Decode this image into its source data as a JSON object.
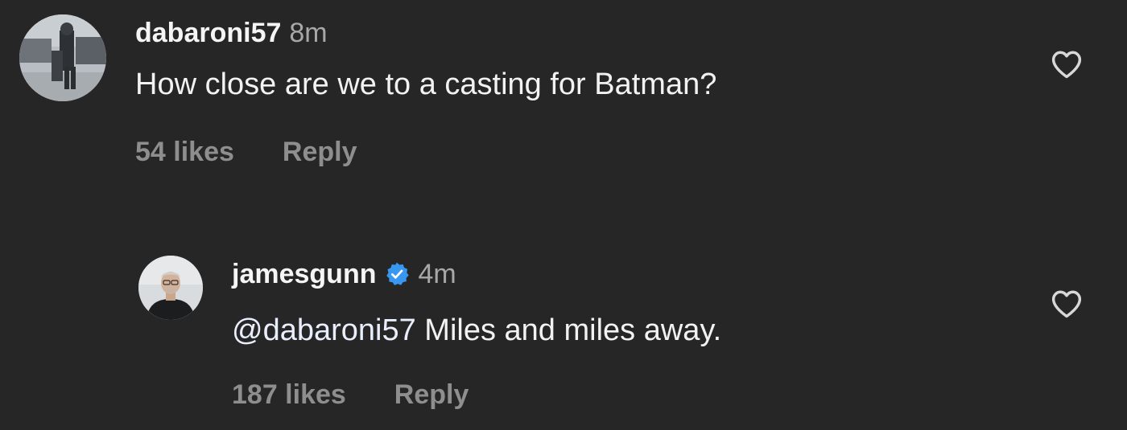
{
  "comments": [
    {
      "username": "dabaroni57",
      "time": "8m",
      "verified": false,
      "mention": "",
      "text": "How close are we to a casting for Batman?",
      "likes": "54 likes",
      "reply_label": "Reply",
      "avatar_icon": "street-photo-avatar",
      "like_icon": "heart-outline-icon"
    },
    {
      "username": "jamesgunn",
      "time": "4m",
      "verified": true,
      "mention": "@dabaroni57",
      "text": " Miles and miles away.",
      "likes": "187 likes",
      "reply_label": "Reply",
      "avatar_icon": "person-portrait-avatar",
      "like_icon": "heart-outline-icon"
    }
  ],
  "colors": {
    "background": "#262626",
    "text_primary": "#f2f2f2",
    "text_secondary": "#a8a8a8",
    "meta": "#8e8e8e",
    "verified_badge": "#3897f0"
  }
}
